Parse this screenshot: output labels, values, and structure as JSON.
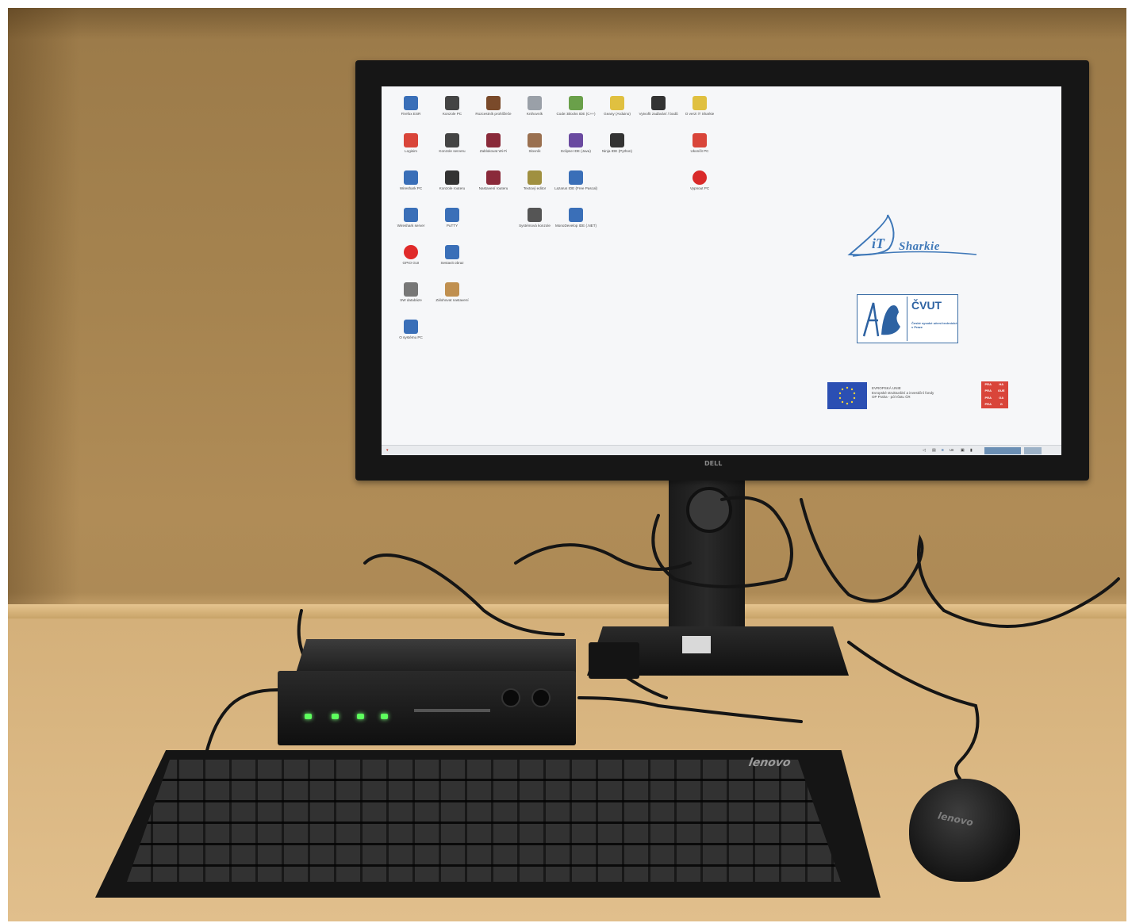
{
  "scene": {
    "description_free": true,
    "colors": {
      "wall": "#a5834f",
      "desk": "#d7b480",
      "monitor_bezel": "#161616",
      "screen_bg": "#f6f7f9",
      "led": "#5dff5d"
    }
  },
  "monitor": {
    "brand": "DELL"
  },
  "desktop": {
    "icons": [
      {
        "label": "Firefox ESR",
        "icon": "firefox-icon",
        "color": "#3a6fb8"
      },
      {
        "label": "Konzole PC",
        "icon": "monitor-icon",
        "color": "#444444"
      },
      {
        "label": "Rozcestník prohlížeče",
        "icon": "pen-icon",
        "color": "#7a4a2a"
      },
      {
        "label": "Knihovník",
        "icon": "book-icon",
        "color": "#9aa0a8"
      },
      {
        "label": "Code::Blocks IDE (C++)",
        "icon": "blocks-icon",
        "color": "#6aa04a"
      },
      {
        "label": "Geany (Arduino)",
        "icon": "lamp-icon",
        "color": "#e0c040"
      },
      {
        "label": "Vytvořit zadávání / bodů",
        "icon": "gear-icon",
        "color": "#333333"
      },
      {
        "label": "O verzi iT Sharkie",
        "icon": "star-icon",
        "color": "#e0c040"
      },
      {
        "label": "Logisim",
        "icon": "logisim-icon",
        "color": "#d9453a"
      },
      {
        "label": "Konzole serveru",
        "icon": "server-icon",
        "color": "#444444"
      },
      {
        "label": "Zablokovat Wi-Fi",
        "icon": "wifi-block-icon",
        "color": "#8a2a3a"
      },
      {
        "label": "Slovník",
        "icon": "dictionary-icon",
        "color": "#9a7050"
      },
      {
        "label": "Eclipse IDE (Java)",
        "icon": "eclipse-icon",
        "color": "#6a4aa0"
      },
      {
        "label": "Ninja IDE (Python)",
        "icon": "python-icon",
        "color": "#333333"
      },
      {
        "label": "Ukončit PC",
        "icon": "exit-icon",
        "color": "#d9453a"
      },
      {
        "label": "Wireshark PC",
        "icon": "wireshark-icon",
        "color": "#3a6fb8"
      },
      {
        "label": "Konzole routeru",
        "icon": "router-icon",
        "color": "#333333"
      },
      {
        "label": "Nastavení routeru",
        "icon": "router-settings-icon",
        "color": "#8a2a3a"
      },
      {
        "label": "Textový editor",
        "icon": "editor-icon",
        "color": "#a09040"
      },
      {
        "label": "Lazarus IDE (Free Pascal)",
        "icon": "lazarus-icon",
        "color": "#3a6fb8"
      },
      {
        "label": "Vypnout PC",
        "icon": "power-icon",
        "color": "#d92a2a"
      },
      {
        "label": "Wireshark server",
        "icon": "wireshark-server-icon",
        "color": "#3a6fb8"
      },
      {
        "label": "PuTTY",
        "icon": "putty-icon",
        "color": "#3a6fb8"
      },
      {
        "label": "Systémová konzole",
        "icon": "terminal-icon",
        "color": "#555555"
      },
      {
        "label": "MonoDevelop IDE (.NET)",
        "icon": "monodevelop-icon",
        "color": "#3a6fb8"
      },
      {
        "label": "GPIO GUI",
        "icon": "record-icon",
        "color": "#e02a2a"
      },
      {
        "label": "Sestavit obraz",
        "icon": "image-builder-icon",
        "color": "#3a6fb8"
      },
      {
        "label": "SW databáze",
        "icon": "database-icon",
        "color": "#777777"
      },
      {
        "label": "Zálohovat nastavení",
        "icon": "backup-icon",
        "color": "#c09050"
      },
      {
        "label": "O systému PC",
        "icon": "about-pc-icon",
        "color": "#3a6fb8"
      }
    ],
    "logos": {
      "sharkie": "Sharkie",
      "sharkie_prefix": "iT",
      "cvut_name": "ČVUT",
      "cvut_sub": "České vysoké učení technické v Praze",
      "eu_text_1": "EVROPSKÁ UNIE",
      "eu_text_2": "Evropské strukturální a investiční fondy",
      "eu_text_3": "OP Praha - pól růstu ČR",
      "praha_cells": [
        "PRA",
        "HA",
        "PRA",
        "GUE",
        "PRA",
        "GA",
        "PRA",
        "G"
      ]
    },
    "taskbar": {
      "layout_label": "us"
    }
  },
  "keyboard": {
    "brand": "lenovo"
  },
  "mouse": {
    "brand": "lenovo"
  }
}
